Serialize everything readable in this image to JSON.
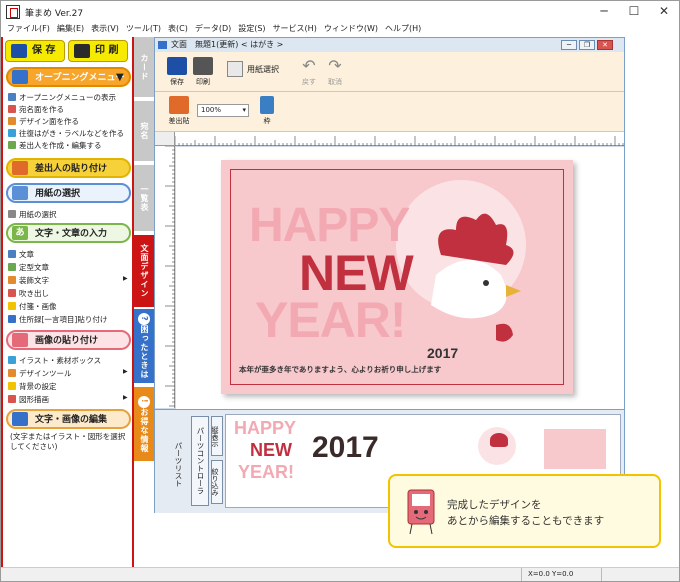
{
  "window": {
    "title": "筆まめ Ver.27",
    "minimize": "─",
    "maximize": "☐",
    "close": "✕"
  },
  "menubar": [
    "ファイル(F)",
    "編集(E)",
    "表示(V)",
    "ツール(T)",
    "表(C)",
    "データ(D)",
    "設定(S)",
    "サービス(H)",
    "ウィンドウ(W)",
    "ヘルプ(H)"
  ],
  "leftpanel": {
    "save_label": "保 存",
    "print_label": "印 刷",
    "opening_menu": "オープニングメニュー",
    "opening_items": [
      "オープニングメニューの表示",
      "宛名面を作る",
      "デザイン面を作る",
      "往復はがき・ラベルなどを作る",
      "差出人を作成・編集する"
    ],
    "sender_paste": "差出人の貼り付け",
    "paper_select": "用紙の選択",
    "paper_items": [
      "用紙の選択"
    ],
    "text_input": "文字・文章の入力",
    "text_icon": "あ",
    "text_items": [
      "文章",
      "定型文章",
      "装飾文字",
      "吹き出し",
      "付箋・画像",
      "住所録[一言項目]貼り付け"
    ],
    "image_paste": "画像の貼り付け",
    "image_items": [
      "イラスト・素材ボックス",
      "デザインツール",
      "背景の設定",
      "図形描画"
    ],
    "edit_section": "文字・画像の編集",
    "edit_note": "(文字またはイラスト・図形を選択してください)"
  },
  "vtabs": {
    "card": "カード",
    "addr": "宛名",
    "list": "一覧表",
    "design": "文面デザイン",
    "trouble": "困ったときは",
    "bargain": "お得な情報"
  },
  "docwin": {
    "title": "文面　無題1(更新) < はがき >",
    "toolbar": {
      "save": "保存",
      "print": "印刷",
      "paper": "用紙選択",
      "undo": "戻す",
      "redo": "取消",
      "sender": "差出貼",
      "zoom": "100%",
      "frame": "枠"
    }
  },
  "card": {
    "happy": "HAPPY",
    "new": "NEW",
    "year": "YEAR!",
    "year_num": "2017",
    "message": "本年が亜多き年でありますよう、心よりお祈り申し上げます",
    "bg": "#f7c8cc",
    "accent": "#c0303f"
  },
  "parts": {
    "side_label": "パーツリスト",
    "controller": "パーツコントローラ",
    "vertical_label": "縦表示",
    "filter_label": "絞り込み",
    "thumb_happy": "HAPPY",
    "thumb_new": "NEW",
    "thumb_year": "YEAR!",
    "thumb_num": "2017"
  },
  "callout": {
    "line1": "完成したデザインを",
    "line2": "あとから編集することもできます"
  },
  "statusbar": {
    "coords": "X=0.0  Y=0.0"
  }
}
